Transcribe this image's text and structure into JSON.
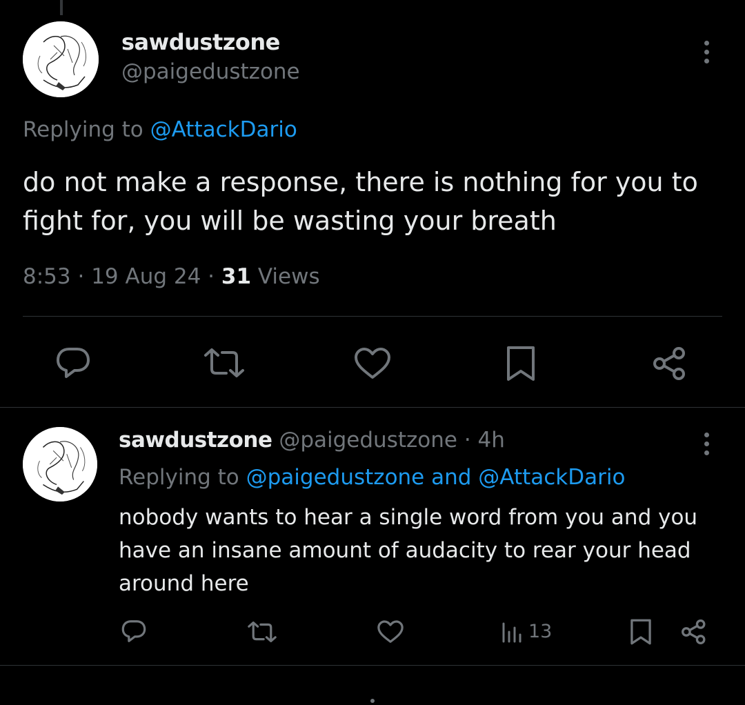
{
  "main_tweet": {
    "display_name": "sawdustzone",
    "handle": "@paigedustzone",
    "replying_prefix": "Replying to ",
    "replying_to": "@AttackDario",
    "text": "do not make a response, there is nothing for you to fight for, you will be wasting your breath",
    "time": "8:53",
    "date": "19 Aug 24",
    "views_count": "31",
    "views_label": "Views",
    "separator": " · "
  },
  "reply_tweet": {
    "display_name": "sawdustzone",
    "handle": "@paigedustzone",
    "time_ago": "4h",
    "separator": " · ",
    "replying_prefix": "Replying to ",
    "replying_to": "@paigedustzone and @AttackDario",
    "text": "nobody wants to hear a single word from you and you have an insane amount of audacity to rear your head around here",
    "views_count": "13"
  },
  "icons": {
    "reply": "reply-icon",
    "retweet": "retweet-icon",
    "like": "heart-icon",
    "bookmark": "bookmark-icon",
    "share": "share-icon",
    "views": "views-bar-icon",
    "more": "more-dots-icon"
  },
  "colors": {
    "background": "#000000",
    "text_primary": "#e7e9ea",
    "text_secondary": "#71767b",
    "link": "#1d9bf0",
    "divider": "#2f3336"
  }
}
